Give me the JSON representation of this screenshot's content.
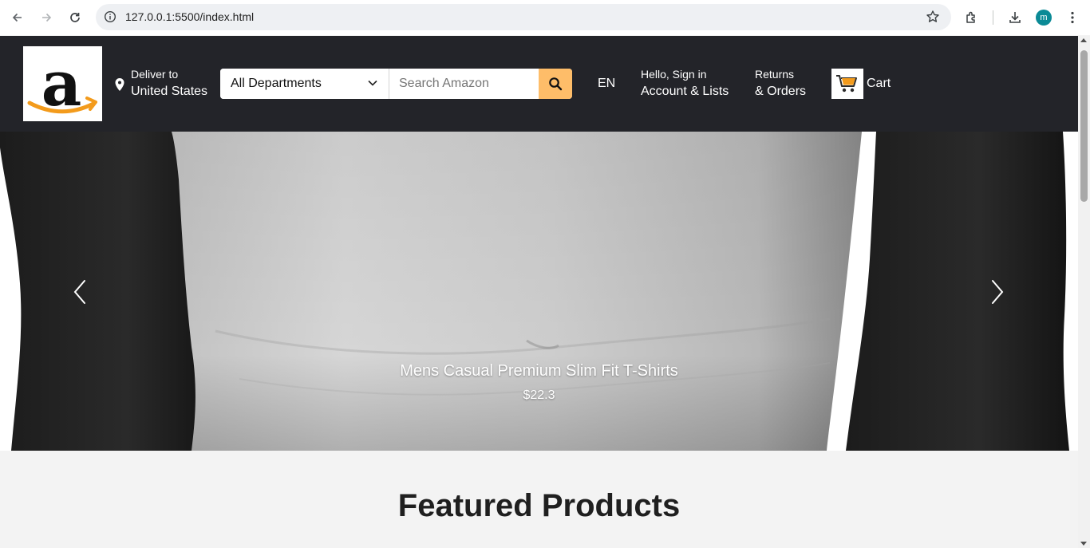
{
  "browser": {
    "url": "127.0.0.1:5500/index.html",
    "profile_initial": "m"
  },
  "header": {
    "deliver_label": "Deliver to",
    "deliver_location": "United States",
    "search": {
      "department": "All Departments",
      "placeholder": "Search Amazon"
    },
    "language": "EN",
    "account_line1": "Hello, Sign in",
    "account_line2": "Account & Lists",
    "orders_line1": "Returns",
    "orders_line2": "& Orders",
    "cart_label": "Cart"
  },
  "carousel": {
    "product_name": "Mens Casual Premium Slim Fit T-Shirts",
    "price": "$22.3"
  },
  "featured": {
    "heading": "Featured Products"
  },
  "colors": {
    "nav_bg": "#232429",
    "search_button": "#febd69",
    "logo_orange": "#f39b1c"
  }
}
